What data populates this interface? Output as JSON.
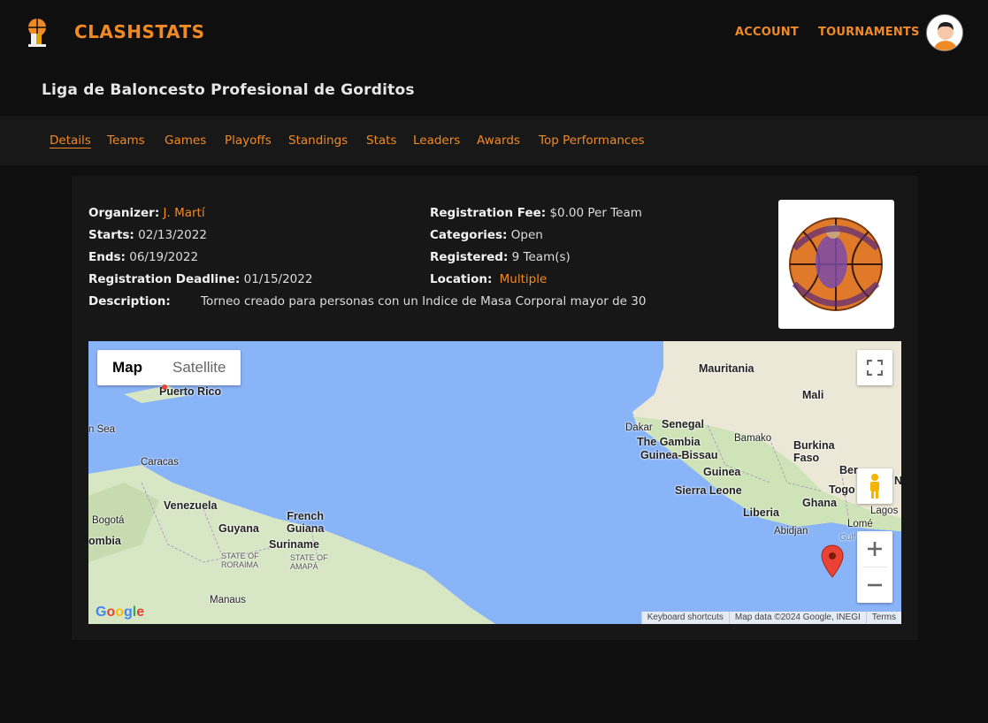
{
  "header": {
    "brand": "CLASHSTATS",
    "nav": {
      "account": "ACCOUNT",
      "tournaments": "TOURNAMENTS"
    },
    "accent_color": "#f08a24"
  },
  "league": {
    "title": "Liga de Baloncesto Profesional de Gorditos"
  },
  "tabs": [
    {
      "label": "Details",
      "active": true
    },
    {
      "label": "Teams"
    },
    {
      "label": "Games"
    },
    {
      "label": "Playoffs"
    },
    {
      "label": "Standings"
    },
    {
      "label": "Stats"
    },
    {
      "label": "Leaders"
    },
    {
      "label": "Awards"
    },
    {
      "label": "Top Performances"
    }
  ],
  "details": {
    "organizer": {
      "label": "Organizer:",
      "value": "J. Martí"
    },
    "starts": {
      "label": "Starts:",
      "value": "02/13/2022"
    },
    "ends": {
      "label": "Ends:",
      "value": "06/19/2022"
    },
    "deadline": {
      "label": "Registration Deadline:",
      "value": "01/15/2022"
    },
    "description": {
      "label": "Description:",
      "value": "Torneo creado para personas con un Indice de Masa Corporal mayor de 30"
    },
    "fee": {
      "label": "Registration Fee:",
      "value": "$0.00 Per Team"
    },
    "categories": {
      "label": "Categories:",
      "value": "Open"
    },
    "registered": {
      "label": "Registered:",
      "value": "9 Team(s)"
    },
    "location": {
      "label": "Location:",
      "value": "Multiple"
    }
  },
  "map": {
    "type_map": "Map",
    "type_satellite": "Satellite",
    "labels": {
      "puerto_rico": "Puerto Rico",
      "sea": "n Sea",
      "caracas": "Caracas",
      "venezuela": "Venezuela",
      "bogota": "Bogotá",
      "colombia": "ombia",
      "guyana": "Guyana",
      "suriname": "Suriname",
      "french_guiana": "French\nGuiana",
      "roraima": "STATE OF\nRORAIMA",
      "amapa": "STATE OF\nAMAPÁ",
      "manaus": "Manaus",
      "mauritania": "Mauritania",
      "mali": "Mali",
      "dakar": "Dakar",
      "senegal": "Senegal",
      "gambia": "The Gambia",
      "guinea_bissau": "Guinea-Bissau",
      "bamako": "Bamako",
      "burkina": "Burkina\nFaso",
      "guinea": "Guinea",
      "sierra_leone": "Sierra Leone",
      "liberia": "Liberia",
      "ghana": "Ghana",
      "togo": "Togo",
      "benin": "Ber",
      "lagos": "Lagos",
      "lome": "Lomé",
      "abidjan": "Abidjan",
      "gulf": "Gulf",
      "nig": "N"
    },
    "attribution": {
      "shortcuts": "Keyboard shortcuts",
      "data": "Map data ©2024 Google, INEGI",
      "terms": "Terms"
    },
    "google": "Google",
    "ocean_color": "#8ab4f8",
    "land_color": "#d8e8c8"
  }
}
